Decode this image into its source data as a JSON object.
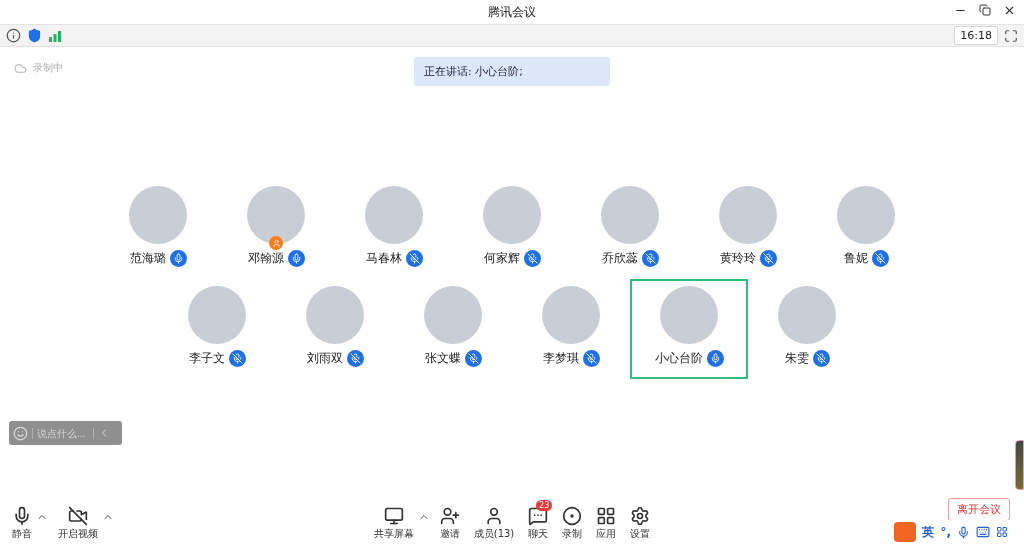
{
  "window": {
    "title": "腾讯会议"
  },
  "info_bar": {
    "time": "16:18"
  },
  "recording": {
    "label": "录制中"
  },
  "speaking_banner": "正在讲话: 小心台阶;",
  "participants": [
    {
      "name": "范海璐",
      "muted": false,
      "host": false,
      "selected": false
    },
    {
      "name": "邓翰源",
      "muted": false,
      "host": true,
      "selected": false
    },
    {
      "name": "马春林",
      "muted": true,
      "host": false,
      "selected": false
    },
    {
      "name": "何家辉",
      "muted": true,
      "host": false,
      "selected": false
    },
    {
      "name": "乔欣蕊",
      "muted": true,
      "host": false,
      "selected": false
    },
    {
      "name": "黄玲玲",
      "muted": true,
      "host": false,
      "selected": false
    },
    {
      "name": "鲁妮",
      "muted": true,
      "host": false,
      "selected": false
    },
    {
      "name": "李子文",
      "muted": true,
      "host": false,
      "selected": false
    },
    {
      "name": "刘雨双",
      "muted": true,
      "host": false,
      "selected": false
    },
    {
      "name": "张文蝶",
      "muted": true,
      "host": false,
      "selected": false
    },
    {
      "name": "李梦琪",
      "muted": true,
      "host": false,
      "selected": false
    },
    {
      "name": "小心台阶",
      "muted": false,
      "host": false,
      "selected": true
    },
    {
      "name": "朱雯",
      "muted": true,
      "host": false,
      "selected": false
    }
  ],
  "chat_input": {
    "placeholder": "说点什么..."
  },
  "toolbar_left": [
    {
      "kind": "mic",
      "label": "静音",
      "menu": true
    },
    {
      "kind": "video",
      "label": "开启视频",
      "menu": true
    }
  ],
  "toolbar_center": [
    {
      "kind": "share",
      "label": "共享屏幕",
      "menu": true
    },
    {
      "kind": "invite",
      "label": "邀请",
      "menu": false
    },
    {
      "kind": "members",
      "label": "成员(13)",
      "menu": false
    },
    {
      "kind": "chat",
      "label": "聊天",
      "menu": false,
      "badge": "23"
    },
    {
      "kind": "record",
      "label": "录制",
      "menu": false
    },
    {
      "kind": "apps",
      "label": "应用",
      "menu": false
    },
    {
      "kind": "settings",
      "label": "设置",
      "menu": false
    }
  ],
  "leave_button": "离开会议",
  "ime_bar": {
    "mode": "英",
    "punctuation": "°,"
  }
}
